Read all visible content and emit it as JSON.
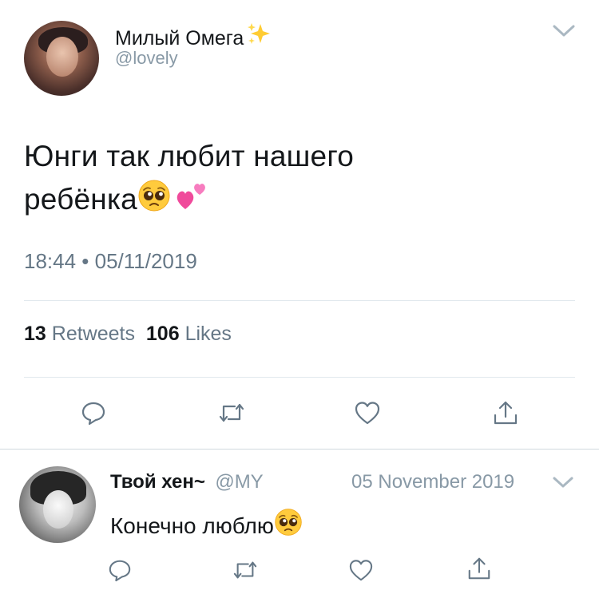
{
  "tweet": {
    "display_name": "Милый Омега",
    "name_emoji": "sparkles",
    "handle": "@lovely",
    "text_line1": "Юнги так любит нашего",
    "text_line2": "ребёнка",
    "text_emojis": [
      "pleading-face",
      "two-hearts"
    ],
    "timestamp": "18:44 • 05/11/2019",
    "retweets_count": "13",
    "retweets_label": "Retweets",
    "likes_count": "106",
    "likes_label": "Likes",
    "actions": [
      "reply-icon",
      "retweet-icon",
      "like-icon",
      "share-icon"
    ]
  },
  "reply": {
    "display_name": "Твой хен~",
    "handle": "@MY",
    "date": "05 November 2019",
    "text": "Конечно люблю",
    "text_emoji": "pleading-face",
    "actions": [
      "reply-icon",
      "retweet-icon",
      "like-icon",
      "share-icon"
    ]
  },
  "colors": {
    "primary_text": "#14171a",
    "secondary_text": "#657786",
    "divider": "#e1e8ed",
    "icon": "#657786"
  }
}
